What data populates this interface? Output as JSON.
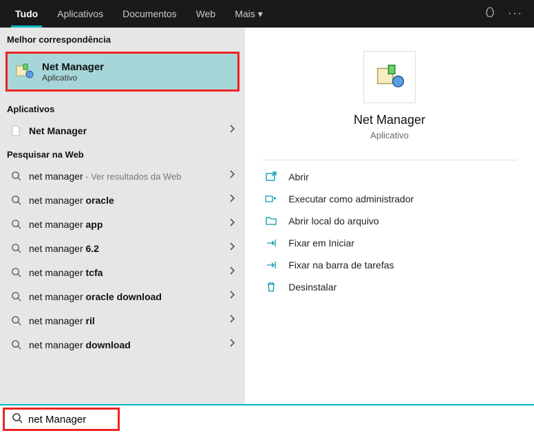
{
  "topbar": {
    "tabs": [
      "Tudo",
      "Aplicativos",
      "Documentos",
      "Web",
      "Mais"
    ],
    "activeIndex": 0
  },
  "left": {
    "bestMatchLabel": "Melhor correspondência",
    "bestMatch": {
      "title": "Net Manager",
      "subtitle": "Aplicativo"
    },
    "appsLabel": "Aplicativos",
    "apps": [
      {
        "prefix": "",
        "bold": "Net Manager",
        "suffix": ""
      }
    ],
    "webLabel": "Pesquisar na Web",
    "web": [
      {
        "prefix": "net manager",
        "bold": "",
        "suffix": " - Ver resultados da Web",
        "dimSuffix": true
      },
      {
        "prefix": "net manager ",
        "bold": "oracle",
        "suffix": ""
      },
      {
        "prefix": "net manager ",
        "bold": "app",
        "suffix": ""
      },
      {
        "prefix": "net manager ",
        "bold": "6.2",
        "suffix": ""
      },
      {
        "prefix": "net manager ",
        "bold": "tcfa",
        "suffix": ""
      },
      {
        "prefix": "net manager ",
        "bold": "oracle download",
        "suffix": ""
      },
      {
        "prefix": "net manager ",
        "bold": "ril",
        "suffix": ""
      },
      {
        "prefix": "net manager ",
        "bold": "download",
        "suffix": ""
      }
    ]
  },
  "right": {
    "title": "Net Manager",
    "subtitle": "Aplicativo",
    "actions": [
      {
        "icon": "open",
        "label": "Abrir"
      },
      {
        "icon": "admin",
        "label": "Executar como administrador"
      },
      {
        "icon": "folder",
        "label": "Abrir local do arquivo"
      },
      {
        "icon": "pin-start",
        "label": "Fixar em Iniciar"
      },
      {
        "icon": "pin-task",
        "label": "Fixar na barra de tarefas"
      },
      {
        "icon": "uninstall",
        "label": "Desinstalar"
      }
    ]
  },
  "search": {
    "value": "net Manager"
  }
}
